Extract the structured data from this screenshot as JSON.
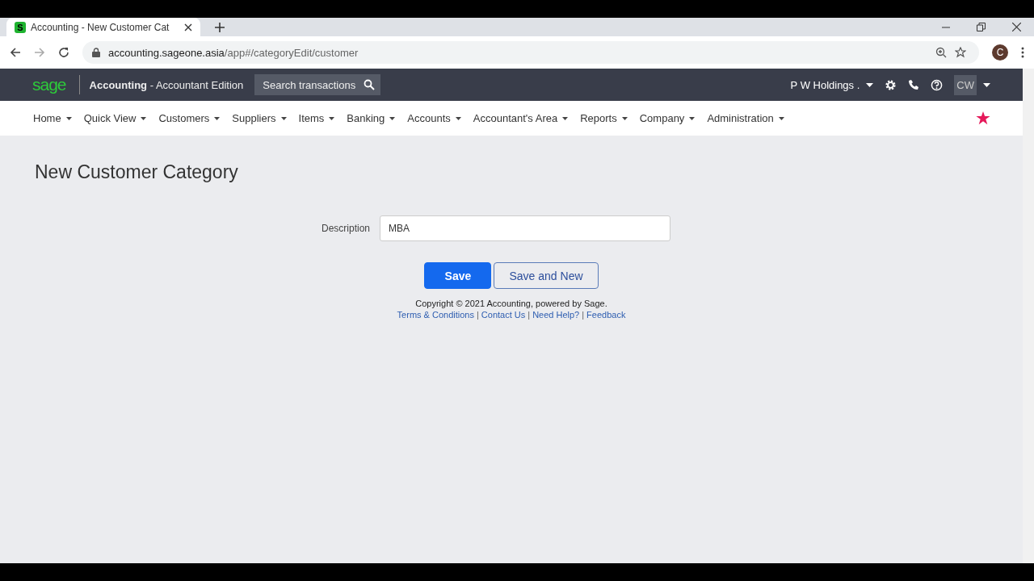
{
  "browser": {
    "favicon_letter": "S",
    "tab_title": "Accounting - New Customer Cat",
    "url_host": "accounting.sageone.asia",
    "url_path": "/app#/categoryEdit/customer",
    "profile_initial": "C"
  },
  "header": {
    "logo": "sage",
    "product": "Accounting",
    "separator": "-",
    "edition": "Accountant Edition",
    "search_placeholder": "Search transactions",
    "company": "P W Holdings .",
    "user_initials": "CW"
  },
  "nav": [
    "Home",
    "Quick View",
    "Customers",
    "Suppliers",
    "Items",
    "Banking",
    "Accounts",
    "Accountant's Area",
    "Reports",
    "Company",
    "Administration"
  ],
  "page": {
    "title": "New Customer Category",
    "fields": [
      {
        "label": "Description",
        "value": "MBA"
      }
    ],
    "buttons": [
      {
        "label": "Save",
        "kind": "primary"
      },
      {
        "label": "Save and New",
        "kind": "secondary"
      }
    ]
  },
  "footer": {
    "copyright": "Copyright © 2021 Accounting, powered by Sage.",
    "links": [
      "Terms & Conditions",
      "Contact Us",
      "Need Help?",
      "Feedback"
    ],
    "link_separator": "|"
  }
}
